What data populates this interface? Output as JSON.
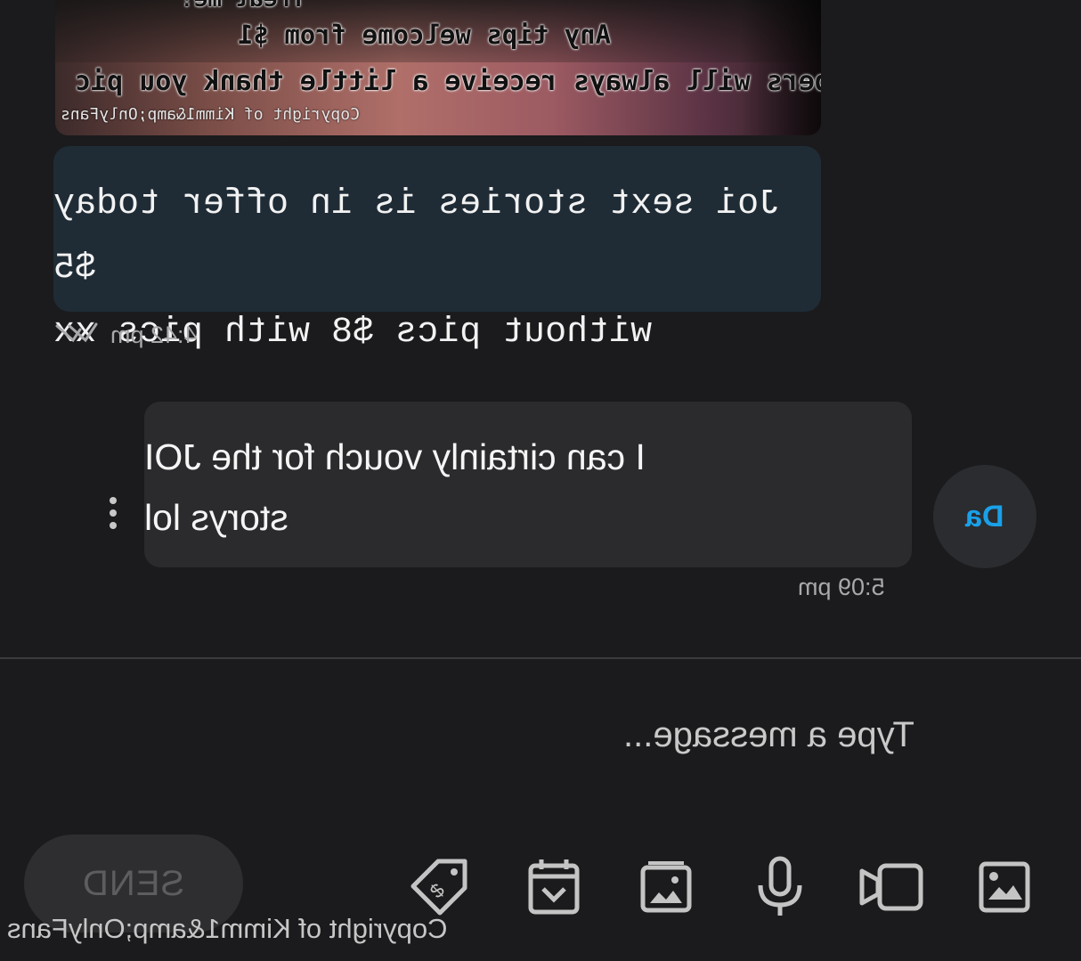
{
  "attachment": {
    "caption_top": "Treat me!",
    "caption_line_1": "Any tips welcome from $1",
    "caption_line_2": "Tippers will always receive a little thank you pic",
    "copyright": "Copyright of Kimm1&amp;OnlyFans"
  },
  "messages": [
    {
      "direction": "incoming",
      "text": "Joi sext stories is in offer today $5\nwithout pics $8 with pics xx",
      "time": "4:42 pm",
      "read_icon": "double-check-icon"
    },
    {
      "direction": "outgoing",
      "text": "I can cirtainly vouch for the JOI\nstorys lol",
      "time": "5:09 pm",
      "avatar_initials": "Da"
    }
  ],
  "composer": {
    "placeholder": "Type a message...",
    "send_label": "SEND",
    "tools": [
      "image-icon",
      "video-icon",
      "microphone-icon",
      "gallery-icon",
      "schedule-icon",
      "price-tag-icon"
    ]
  },
  "watermark": "Copyright of Kimm1&amp;OnlyFans",
  "colors": {
    "background": "#1b1b1d",
    "incoming_bubble": "#1f2c36",
    "outgoing_bubble": "#2b2b2e",
    "avatar_text": "#1aa0e8",
    "send_button": "#2e2e30"
  }
}
